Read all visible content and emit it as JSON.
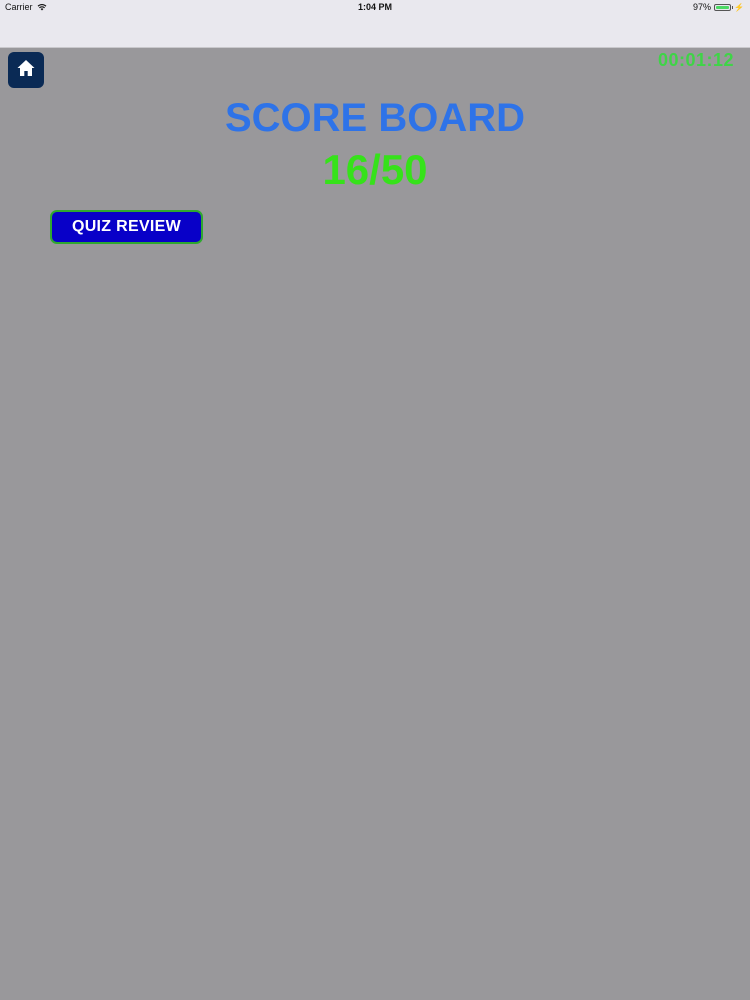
{
  "status_bar": {
    "carrier": "Carrier",
    "time": "1:04 PM",
    "battery_percent": "97%",
    "battery_level": 0.97,
    "battery_color": "#4cd964"
  },
  "header": {
    "home_icon": "home-icon",
    "timer": "00:01:12"
  },
  "scoreboard": {
    "title": "SCORE BOARD",
    "score": "16/50",
    "title_color": "#2e73e8",
    "score_color": "#36e21a"
  },
  "actions": {
    "quiz_review_label": "QUIZ REVIEW"
  }
}
